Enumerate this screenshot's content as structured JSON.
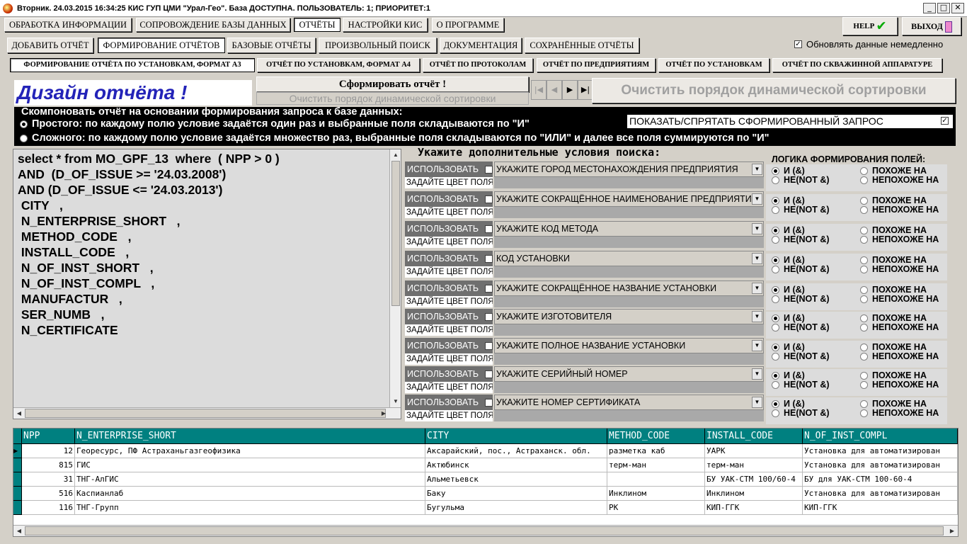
{
  "title": "Вторник. 24.03.2015 16:34:25 КИС ГУП ЦМИ \"Урал-Гео\". База ДОСТУПНА. ПОЛЬЗОВАТЕЛЬ: 1; ПРИОРИТЕТ:1",
  "menu": [
    "ОБРАБОТКА ИНФОРМАЦИИ",
    "СОПРОВОЖДЕНИЕ БАЗЫ ДАННЫХ",
    "ОТЧЁТЫ",
    "НАСТРОЙКИ КИС",
    "О ПРОГРАММЕ"
  ],
  "help_label": "HELP",
  "exit_label": "ВЫХОД",
  "tabs2": [
    "ДОБАВИТЬ ОТЧЁТ",
    "ФОРМИРОВАНИЕ ОТЧЁТОВ",
    "БАЗОВЫЕ ОТЧЁТЫ",
    "ПРОИЗВОЛЬНЫЙ ПОИСК",
    "ДОКУМЕНТАЦИЯ",
    "СОХРАНЁННЫЕ ОТЧЁТЫ"
  ],
  "update_label": "Обновлять данные немедленно",
  "tabs3": [
    "ФОРМИРОВАНИЕ ОТЧЁТА ПО УСТАНОВКАМ, ФОРМАТ А3",
    "ОТЧЁТ ПО УСТАНОВКАМ, ФОРМАТ А4",
    "ОТЧЁТ ПО ПРОТОКОЛАМ",
    "ОТЧЁТ ПО ПРЕДПРИЯТИЯМ",
    "ОТЧЁТ ПО УСТАНОВКАМ",
    "ОТЧЁТ ПО СКВАЖИННОЙ АППАРАТУРЕ"
  ],
  "design_title": "Дизайн отчёта !",
  "form_btn": "Сформировать отчёт !",
  "clear_small": "Очистить порядок динамической сортировки",
  "clear_big": "Очистить порядок динамической сортировки",
  "nav": [
    "|◀",
    "◀",
    "▶",
    "▶|"
  ],
  "group": {
    "legend": "Скомпоновать отчёт на основании формирования запроса к базе данных:",
    "simple": "Простого: по каждому полю условие задаётся один раз и выбранные поля складываются по \"И\"",
    "complex": "Сложного: по каждому полю условие задаётся множество раз, выбранные поля складываются по \"ИЛИ\" и далее все поля суммируются по \"И\"",
    "show_query": "ПОКАЗАТЬ/СПРЯТАТЬ СФОРМИРОВАННЫЙ ЗАПРОС"
  },
  "sql": [
    "select * from MO_GPF_13  where  ( NPP > 0 )",
    "AND  (D_OF_ISSUE >= '24.03.2008')",
    "AND (D_OF_ISSUE <= '24.03.2013')",
    " CITY   ,",
    " N_ENTERPRISE_SHORT   ,",
    " METHOD_CODE   ,",
    " INSTALL_CODE   ,",
    " N_OF_INST_SHORT   ,",
    " N_OF_INST_COMPL   ,",
    " MANUFACTUR   ,",
    " SER_NUMB   ,",
    " N_CERTIFICATE"
  ],
  "conditions_title": "Укажите дополнительные условия поиска:",
  "use_label": "ИСПОЛЬЗОВАТЬ",
  "color_label": "ЗАДАЙТЕ ЦВЕТ ПОЛЯ",
  "conditions": [
    "УКАЖИТЕ ГОРОД МЕСТОНАХОЖДЕНИЯ ПРЕДПРИЯТИЯ",
    "УКАЖИТЕ СОКРАЩЁННОЕ НАИМЕНОВАНИЕ ПРЕДПРИЯТИЯ",
    "УКАЖИТЕ КОД МЕТОДА",
    "КОД УСТАНОВКИ",
    "УКАЖИТЕ СОКРАЩЁННОЕ НАЗВАНИЕ УСТАНОВКИ",
    "УКАЖИТЕ ИЗГОТОВИТЕЛЯ",
    "УКАЖИТЕ ПОЛНОЕ НАЗВАНИЕ УСТАНОВКИ",
    "УКАЖИТЕ СЕРИЙНЫЙ НОМЕР",
    "УКАЖИТЕ НОМЕР СЕРТИФИКАТА"
  ],
  "logic": {
    "title": "ЛОГИКА ФОРМИРОВАНИЯ ПОЛЕЙ:",
    "and": "И     (&)",
    "not": "НЕ(NOT &)",
    "like": "ПОХОЖЕ НА",
    "notlike": "НЕПОХОЖЕ НА"
  },
  "grid": {
    "columns": [
      "NPP",
      "N_ENTERPRISE_SHORT",
      "CITY",
      "METHOD_CODE",
      "INSTALL_CODE",
      "N_OF_INST_COMPL"
    ],
    "rows": [
      [
        "12",
        "Георесурс, ПФ Астраханьгазгеофизика",
        "Аксарайский, пос., Астраханск. обл.",
        "разметка каб",
        "УАРК",
        "Установка для автоматизирован"
      ],
      [
        "815",
        "ГИС",
        "Актюбинск",
        "терм-ман",
        "терм-ман",
        "Установка для автоматизирован"
      ],
      [
        "31",
        "ТНГ-АлГИС",
        "Альметьевск",
        "",
        "БУ УАК-СТМ 100/60-4",
        "БУ для УАК-СТМ 100-60-4"
      ],
      [
        "516",
        "Каспианлаб",
        "Баку",
        "Инклином",
        "Инклином",
        "Установка для автоматизирован"
      ],
      [
        "116",
        "ТНГ-Групп",
        "Бугульма",
        "РК",
        "КИП-ГГК",
        "КИП-ГГК"
      ]
    ]
  },
  "colors": {
    "teal": "#008080",
    "design_blue": "#2323b8"
  }
}
